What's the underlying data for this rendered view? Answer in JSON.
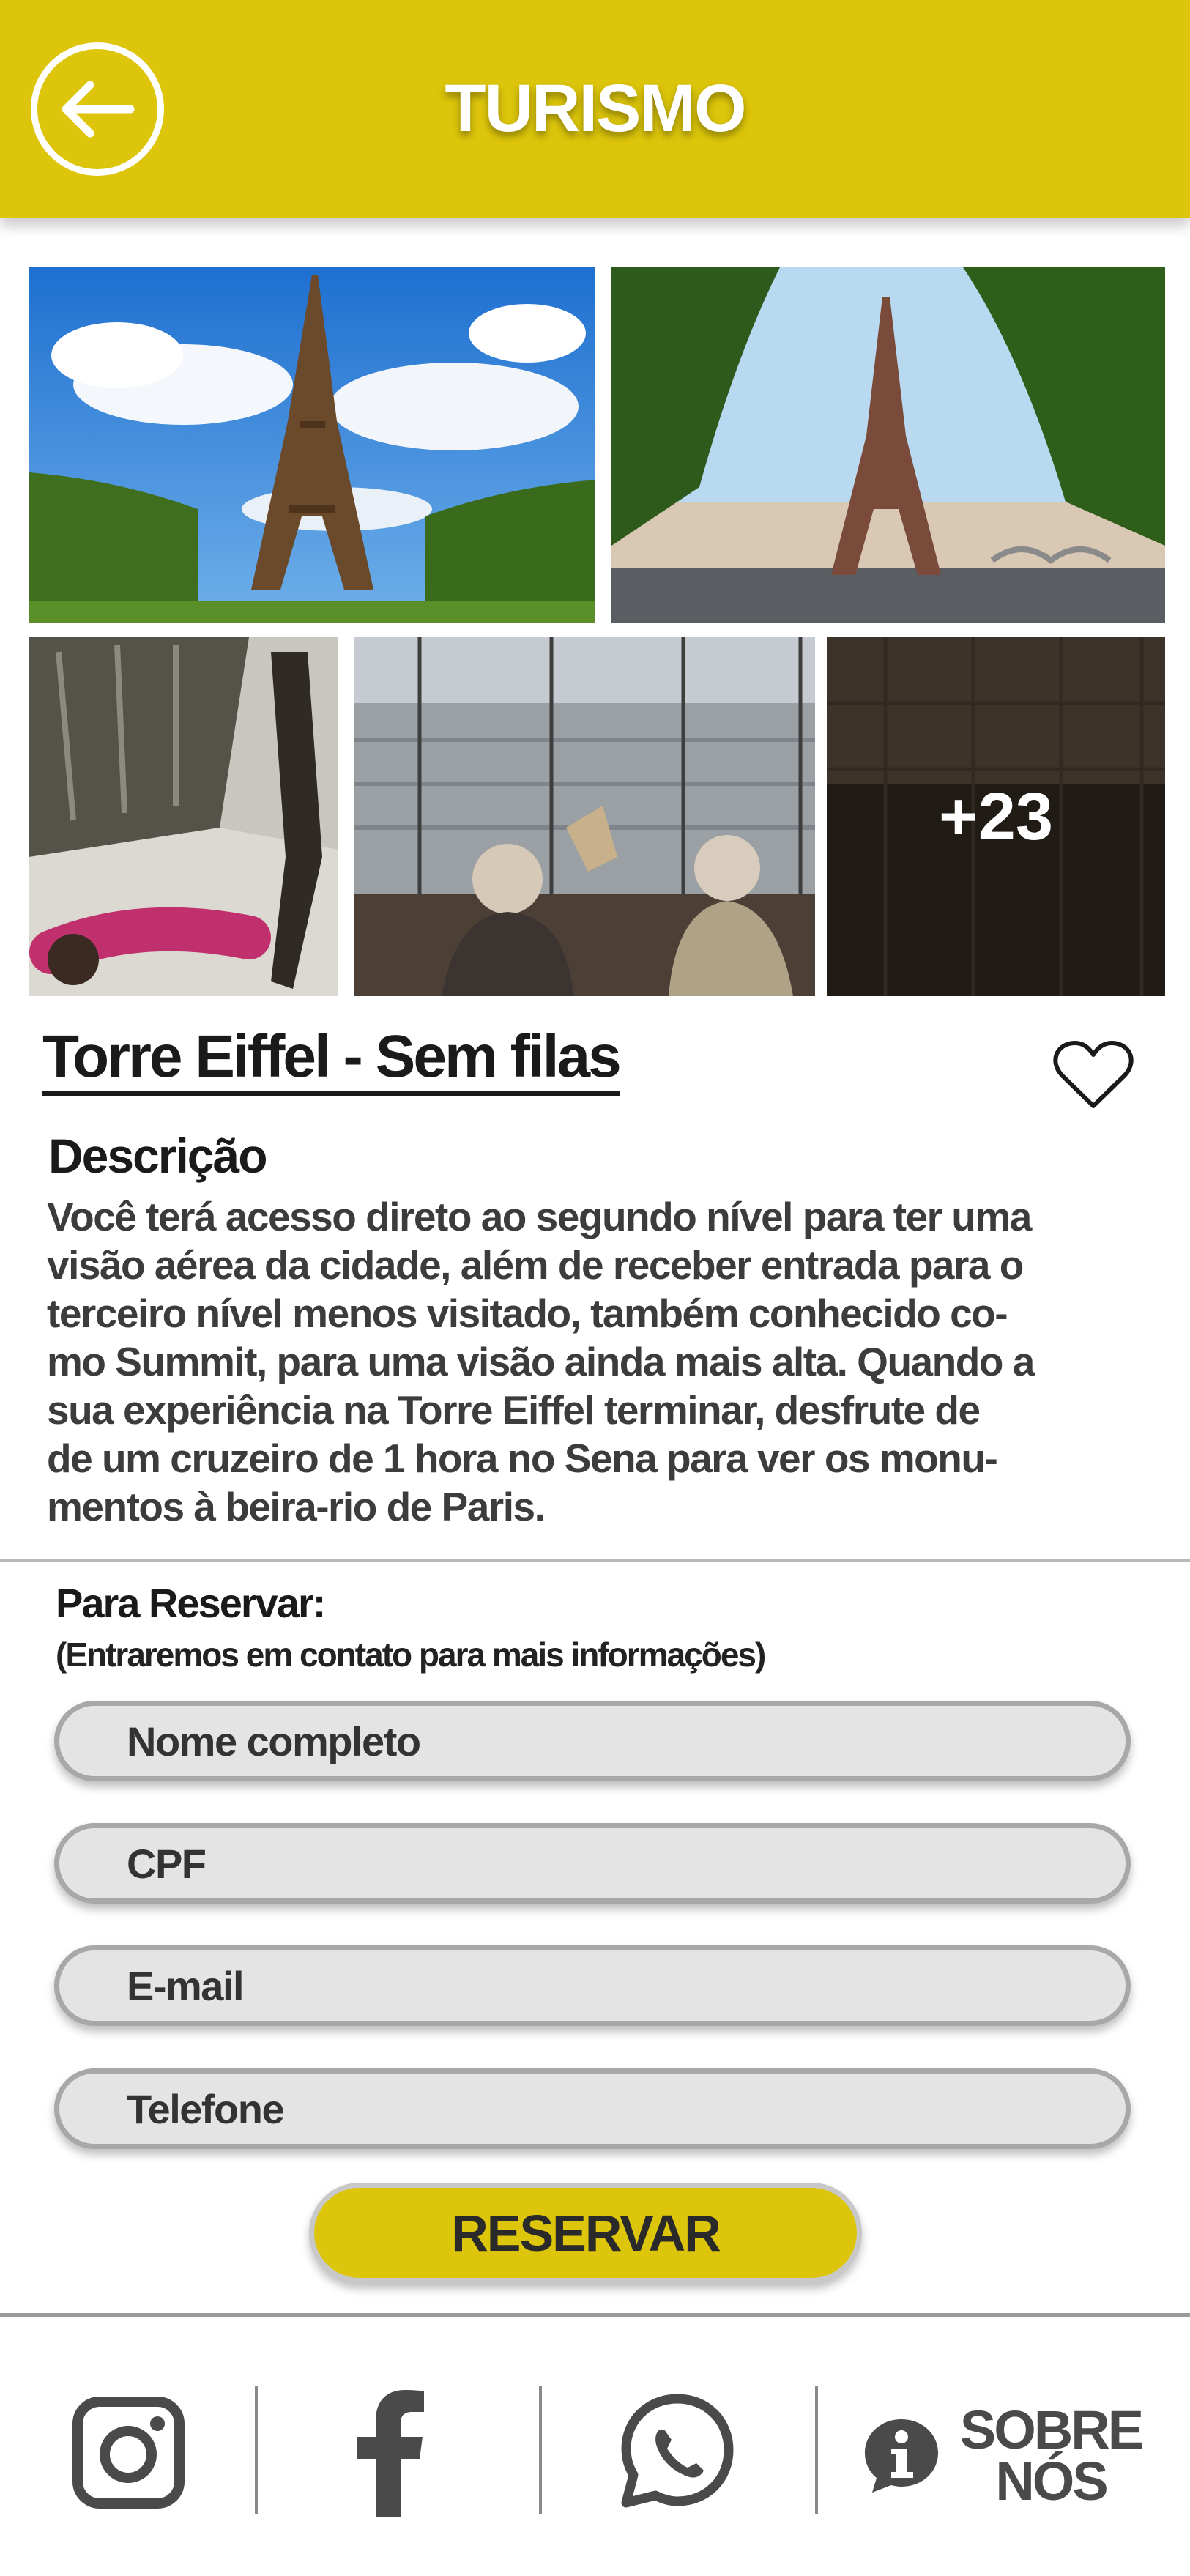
{
  "header": {
    "title": "TURISMO"
  },
  "gallery": {
    "more_count": "+23"
  },
  "place": {
    "title": "Torre Eiffel - Sem filas"
  },
  "description": {
    "heading": "Descrição",
    "lines": [
      "Você terá acesso direto ao segundo nível para ter uma",
      "visão  aérea da cidade, além de receber entrada para o",
      "terceiro nível menos visitado, também conhecido co-",
      "mo Summit, para uma visão  ainda mais alta. Quando a",
      "sua experiência na Torre Eiffel terminar, desfrute de",
      "de um cruzeiro de 1 hora no Sena para ver os monu-",
      "mentos à beira-rio de Paris."
    ]
  },
  "reservation": {
    "label": "Para Reservar:",
    "sublabel": "(Entraremos em contato para mais informações)",
    "fields": [
      {
        "placeholder": "Nome completo",
        "value": ""
      },
      {
        "placeholder": "CPF",
        "value": ""
      },
      {
        "placeholder": "E-mail",
        "value": ""
      },
      {
        "placeholder": "Telefone",
        "value": ""
      }
    ],
    "submit_label": "RESERVAR"
  },
  "footer": {
    "sobre_line1": "SOBRE",
    "sobre_line2": "NÓS",
    "icons": [
      "instagram-icon",
      "facebook-icon",
      "whatsapp-icon",
      "info-icon"
    ]
  },
  "colors": {
    "brand_yellow": "#dcc50a",
    "field_bg": "#e4e4e4",
    "text_dark": "#1a1a1a"
  }
}
